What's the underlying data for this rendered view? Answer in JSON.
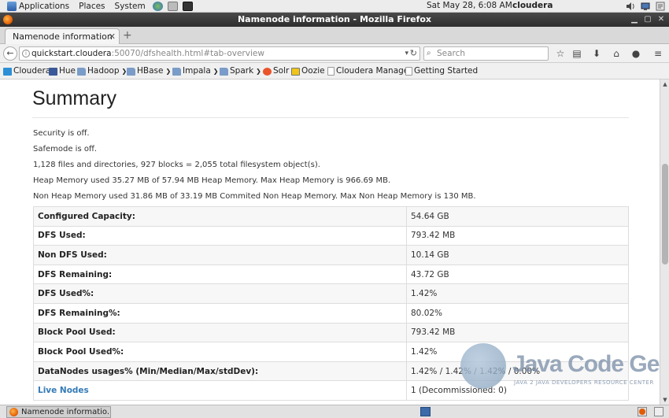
{
  "panel": {
    "menus": [
      "Applications",
      "Places",
      "System"
    ],
    "clock": "Sat May 28,  6:08 AM",
    "user": "cloudera"
  },
  "window": {
    "title": "Namenode information - Mozilla Firefox"
  },
  "tabs": [
    {
      "label": "Namenode information"
    }
  ],
  "navbar": {
    "url_host": "quickstart.cloudera",
    "url_rest": ":50070/dfshealth.html#tab-overview",
    "search_placeholder": "Search"
  },
  "bookmarks": [
    {
      "label": "Cloudera",
      "icon": "cloudera-icon"
    },
    {
      "label": "Hue",
      "icon": "hue-icon"
    },
    {
      "label": "Hadoop",
      "icon": "folder-icon",
      "menu": true
    },
    {
      "label": "HBase",
      "icon": "folder-icon",
      "menu": true
    },
    {
      "label": "Impala",
      "icon": "folder-icon",
      "menu": true
    },
    {
      "label": "Spark",
      "icon": "folder-icon",
      "menu": true
    },
    {
      "label": "Solr",
      "icon": "solr-icon"
    },
    {
      "label": "Oozie",
      "icon": "oozie-icon"
    },
    {
      "label": "Cloudera Manager",
      "icon": "page-icon"
    },
    {
      "label": "Getting Started",
      "icon": "page-icon"
    }
  ],
  "content": {
    "title": "Summary",
    "lines": [
      "Security is off.",
      "Safemode is off.",
      "1,128 files and directories, 927 blocks = 2,055 total filesystem object(s).",
      "Heap Memory used 35.27 MB of 57.94 MB Heap Memory. Max Heap Memory is 966.69 MB.",
      "Non Heap Memory used 31.86 MB of 33.19 MB Commited Non Heap Memory. Max Non Heap Memory is 130 MB."
    ],
    "rows": [
      {
        "key": "Configured Capacity:",
        "value": "54.64 GB"
      },
      {
        "key": "DFS Used:",
        "value": "793.42 MB"
      },
      {
        "key": "Non DFS Used:",
        "value": "10.14 GB"
      },
      {
        "key": "DFS Remaining:",
        "value": "43.72 GB"
      },
      {
        "key": "DFS Used%:",
        "value": "1.42%"
      },
      {
        "key": "DFS Remaining%:",
        "value": "80.02%"
      },
      {
        "key": "Block Pool Used:",
        "value": "793.42 MB"
      },
      {
        "key": "Block Pool Used%:",
        "value": "1.42%"
      },
      {
        "key": "DataNodes usages% (Min/Median/Max/stdDev):",
        "value": "1.42% / 1.42% / 1.42% / 0.00%"
      },
      {
        "key": "Live Nodes",
        "value": "1 (Decommissioned: 0)",
        "link": true
      }
    ]
  },
  "watermark": {
    "brand": "Java Code Geeks",
    "tagline": "JAVA 2 JAVA DEVELOPERS RESOURCE CENTER"
  },
  "taskbar": {
    "window_label": "Namenode informatio..."
  },
  "colors": {
    "link": "#337ab7",
    "title_bar": "#3a3a3a",
    "workspace": "#3d6aa8"
  }
}
